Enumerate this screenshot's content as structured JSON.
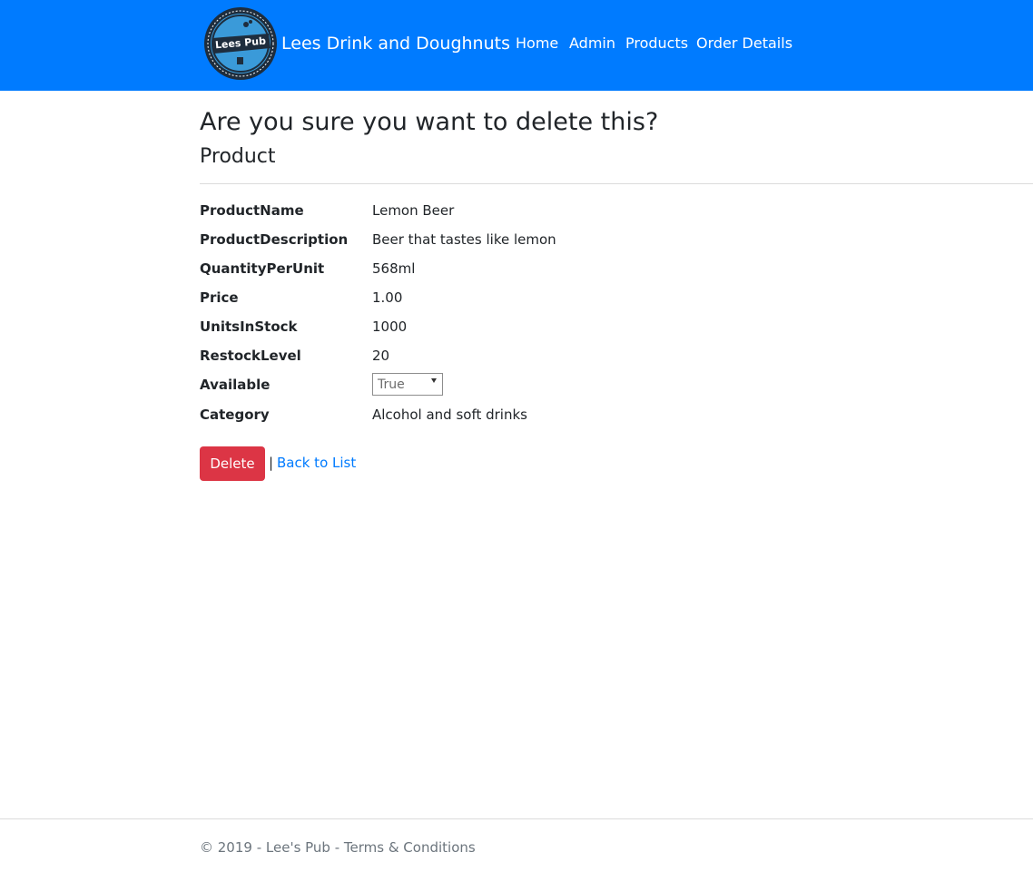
{
  "navbar": {
    "logo_text": "Lees Pub",
    "brand": "Lees Drink and Doughnuts",
    "links": [
      "Home",
      "Admin",
      "Products",
      "Order Details"
    ],
    "background_color": "#007bff"
  },
  "page": {
    "heading": "Are you sure you want to delete this?",
    "subheading": "Product"
  },
  "details": [
    {
      "label": "ProductName",
      "value": "Lemon Beer"
    },
    {
      "label": "ProductDescription",
      "value": "Beer that tastes like lemon"
    },
    {
      "label": "QuantityPerUnit",
      "value": "568ml"
    },
    {
      "label": "Price",
      "value": "1.00"
    },
    {
      "label": "UnitsInStock",
      "value": "1000"
    },
    {
      "label": "RestockLevel",
      "value": "20"
    },
    {
      "label": "Available",
      "value": "True"
    },
    {
      "label": "Category",
      "value": "Alcohol and soft drinks"
    }
  ],
  "actions": {
    "delete_label": "Delete",
    "delete_color": "#dc3545",
    "separator": "|",
    "back_label": "Back to List",
    "link_color": "#007bff"
  },
  "footer": {
    "text": "© 2019 - Lee's Pub - Terms & Conditions"
  }
}
